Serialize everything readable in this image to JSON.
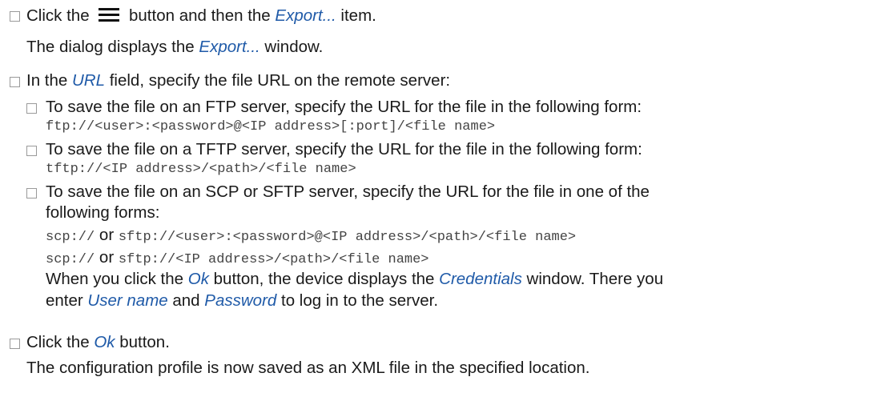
{
  "steps": [
    {
      "pre": "Click the ",
      "icon": "hamburger-menu-icon",
      "mid": " button and then the ",
      "em": "Export...",
      "post": " item."
    }
  ],
  "step1_result": {
    "pre": "The dialog displays the ",
    "em": "Export...",
    "post": " window."
  },
  "step2": {
    "pre": "In the ",
    "em": "URL",
    "post": " field, specify the file URL on the remote server:"
  },
  "ftp": {
    "text": "To save the file on an FTP server, specify the URL for the file in the following form:",
    "code": "ftp://<user>:<password>@<IP address>[:port]/<file name>"
  },
  "tftp": {
    "text": "To save the file on a TFTP server, specify the URL for the file in the following form:",
    "code": "tftp://<IP address>/<path>/<file name>"
  },
  "scp": {
    "text1": "To save the file on an SCP or SFTP server, specify the URL for the file in one of the",
    "text2": "following forms:",
    "code1a": "scp://",
    "or": " or ",
    "code1b": "sftp://<user>:<password>@<IP address>/<path>/<file name>",
    "code2a": "scp://",
    "code2b": "sftp://<IP address>/<path>/<file name>",
    "note_pre": "When you click the ",
    "note_em1": "Ok",
    "note_mid": " button, the device displays the ",
    "note_em2": "Credentials",
    "note_post": " window. There you",
    "note2_pre": "enter ",
    "note2_em1": "User name",
    "note2_mid": " and ",
    "note2_em2": "Password",
    "note2_post": " to log in to the server."
  },
  "step3": {
    "pre": "Click the ",
    "em": "Ok",
    "post": " button."
  },
  "step3_result": "The configuration profile is now saved as an XML file in the specified location."
}
